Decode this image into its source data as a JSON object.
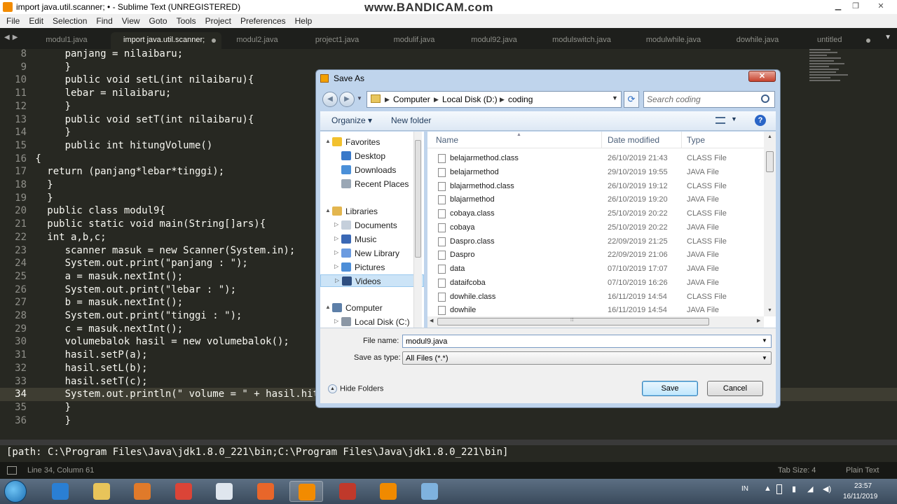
{
  "window": {
    "title": "import java.util.scanner; • - Sublime Text (UNREGISTERED)",
    "watermark": "www.BANDICAM.com",
    "controls": [
      "▁",
      "❐",
      "✕"
    ]
  },
  "menu": [
    "File",
    "Edit",
    "Selection",
    "Find",
    "View",
    "Goto",
    "Tools",
    "Project",
    "Preferences",
    "Help"
  ],
  "tabs": [
    {
      "label": "modul1.java",
      "active": false
    },
    {
      "label": "import java.util.scanner;",
      "active": true
    },
    {
      "label": "modul2.java",
      "active": false
    },
    {
      "label": "project1.java",
      "active": false
    },
    {
      "label": "modulif.java",
      "active": false
    },
    {
      "label": "modul92.java",
      "active": false
    },
    {
      "label": "modulswitch.java",
      "active": false
    },
    {
      "label": "modulwhile.java",
      "active": false
    },
    {
      "label": "dowhile.java",
      "active": false
    },
    {
      "label": "untitled",
      "active": false
    }
  ],
  "editor": {
    "current_line": 34,
    "lines": [
      {
        "n": "8",
        "text": "      panjang = nilaibaru;"
      },
      {
        "n": "9",
        "text": "      }"
      },
      {
        "n": "10",
        "text": "      public void setL(int nilaibaru){"
      },
      {
        "n": "11",
        "text": "      lebar = nilaibaru;"
      },
      {
        "n": "12",
        "text": "      }"
      },
      {
        "n": "13",
        "text": "      public void setT(int nilaibaru){"
      },
      {
        "n": "14",
        "text": "      }"
      },
      {
        "n": "15",
        "text": "      public int hitungVolume()"
      },
      {
        "n": "16",
        "text": " {"
      },
      {
        "n": "17",
        "text": "   return (panjang*lebar*tinggi);"
      },
      {
        "n": "18",
        "text": "   }"
      },
      {
        "n": "19",
        "text": "   }"
      },
      {
        "n": "20",
        "text": "   public class modul9{"
      },
      {
        "n": "21",
        "text": "   public static void main(String[]ars){"
      },
      {
        "n": "22",
        "text": "   int a,b,c;"
      },
      {
        "n": "23",
        "text": "      scanner masuk = new Scanner(System.in);"
      },
      {
        "n": "24",
        "text": "      System.out.print(\"panjang : \");"
      },
      {
        "n": "25",
        "text": "      a = masuk.nextInt();"
      },
      {
        "n": "26",
        "text": "      System.out.print(\"lebar : \");"
      },
      {
        "n": "27",
        "text": "      b = masuk.nextInt();"
      },
      {
        "n": "28",
        "text": "      System.out.print(\"tinggi : \");"
      },
      {
        "n": "29",
        "text": "      c = masuk.nextInt();"
      },
      {
        "n": "30",
        "text": "      volumebalok hasil = new volumebalok();"
      },
      {
        "n": "31",
        "text": "      hasil.setP(a);"
      },
      {
        "n": "32",
        "text": "      hasil.setL(b);"
      },
      {
        "n": "33",
        "text": "      hasil.setT(c);"
      },
      {
        "n": "34",
        "text": "      System.out.println(\" volume = \" + hasil.hitungVolume());"
      },
      {
        "n": "35",
        "text": "      }"
      },
      {
        "n": "36",
        "text": "      }"
      }
    ]
  },
  "console": {
    "text": "[path: C:\\Program Files\\Java\\jdk1.8.0_221\\bin;C:\\Program Files\\Java\\jdk1.8.0_221\\bin]"
  },
  "statusbar": {
    "position": "Line 34, Column 61",
    "tab_size": "Tab Size: 4",
    "syntax": "Plain Text"
  },
  "dialog": {
    "title": "Save As",
    "breadcrumb": [
      "Computer",
      "Local Disk (D:)",
      "coding"
    ],
    "search_placeholder": "Search coding",
    "toolbar": {
      "organize": "Organize ▾",
      "new_folder": "New folder"
    },
    "nav": [
      {
        "label": "Favorites",
        "indent": 0,
        "expander": "▲",
        "icon": "star-icon",
        "color": "#f2c12e"
      },
      {
        "label": "Desktop",
        "indent": 1,
        "expander": "",
        "icon": "desktop-icon",
        "color": "#3a79c9"
      },
      {
        "label": "Downloads",
        "indent": 1,
        "expander": "",
        "icon": "downloads-icon",
        "color": "#4a8fd8"
      },
      {
        "label": "Recent Places",
        "indent": 1,
        "expander": "",
        "icon": "recent-places-icon",
        "color": "#9aa7b5"
      },
      {
        "label": "Libraries",
        "indent": 0,
        "expander": "▲",
        "icon": "libraries-icon",
        "color": "#e3b64f"
      },
      {
        "label": "Documents",
        "indent": 1,
        "expander": "▷",
        "icon": "documents-icon",
        "color": "#c5cfdb"
      },
      {
        "label": "Music",
        "indent": 1,
        "expander": "▷",
        "icon": "music-icon",
        "color": "#3a68b5"
      },
      {
        "label": "New Library",
        "indent": 1,
        "expander": "▷",
        "icon": "library-icon",
        "color": "#6b9be0"
      },
      {
        "label": "Pictures",
        "indent": 1,
        "expander": "▷",
        "icon": "pictures-icon",
        "color": "#4d8ed8"
      },
      {
        "label": "Videos",
        "indent": 1,
        "expander": "▷",
        "icon": "videos-icon",
        "color": "#2e4e80",
        "selected": true
      },
      {
        "label": "Computer",
        "indent": 0,
        "expander": "▲",
        "icon": "computer-icon",
        "color": "#5d7fa8"
      },
      {
        "label": "Local Disk (C:)",
        "indent": 1,
        "expander": "▷",
        "icon": "disk-icon",
        "color": "#8b97a5"
      }
    ],
    "columns": [
      "Name",
      "Date modified",
      "Type"
    ],
    "files": [
      {
        "name": "belajarmethod.class",
        "date": "26/10/2019 21:43",
        "type": "CLASS File"
      },
      {
        "name": "belajarmethod",
        "date": "29/10/2019 19:55",
        "type": "JAVA File"
      },
      {
        "name": "blajarmethod.class",
        "date": "26/10/2019 19:12",
        "type": "CLASS File"
      },
      {
        "name": "blajarmethod",
        "date": "26/10/2019 19:20",
        "type": "JAVA File"
      },
      {
        "name": "cobaya.class",
        "date": "25/10/2019 20:22",
        "type": "CLASS File"
      },
      {
        "name": "cobaya",
        "date": "25/10/2019 20:22",
        "type": "JAVA File"
      },
      {
        "name": "Daspro.class",
        "date": "22/09/2019 21:25",
        "type": "CLASS File"
      },
      {
        "name": "Daspro",
        "date": "22/09/2019 21:06",
        "type": "JAVA File"
      },
      {
        "name": "data",
        "date": "07/10/2019 17:07",
        "type": "JAVA File"
      },
      {
        "name": "dataifcoba",
        "date": "07/10/2019 16:26",
        "type": "JAVA File"
      },
      {
        "name": "dowhile.class",
        "date": "16/11/2019 14:54",
        "type": "CLASS File"
      },
      {
        "name": "dowhile",
        "date": "16/11/2019 14:54",
        "type": "JAVA File"
      }
    ],
    "file_name_label": "File name:",
    "file_name_value": "modul9.java",
    "save_type_label": "Save as type:",
    "save_type_value": "All Files (*.*)",
    "hide_folders": "Hide Folders",
    "save_button": "Save",
    "cancel_button": "Cancel"
  },
  "taskbar": {
    "apps": [
      {
        "name": "ie-icon",
        "color": "#2a7fd4"
      },
      {
        "name": "file-explorer-icon",
        "color": "#e8c45a"
      },
      {
        "name": "media-player-icon",
        "color": "#e07a2a"
      },
      {
        "name": "chrome-icon",
        "color": "#db4437"
      },
      {
        "name": "notepad-icon",
        "color": "#dfe6ee"
      },
      {
        "name": "firefox-icon",
        "color": "#e8662a"
      },
      {
        "name": "sublime-text-icon",
        "color": "#f28b00",
        "active": true
      },
      {
        "name": "bandicam-icon",
        "color": "#c0392b"
      },
      {
        "name": "vlc-icon",
        "color": "#f08a00"
      },
      {
        "name": "app-icon",
        "color": "#7fb2de"
      }
    ],
    "lang": "IN",
    "time": "23:57",
    "date": "16/11/2019"
  }
}
